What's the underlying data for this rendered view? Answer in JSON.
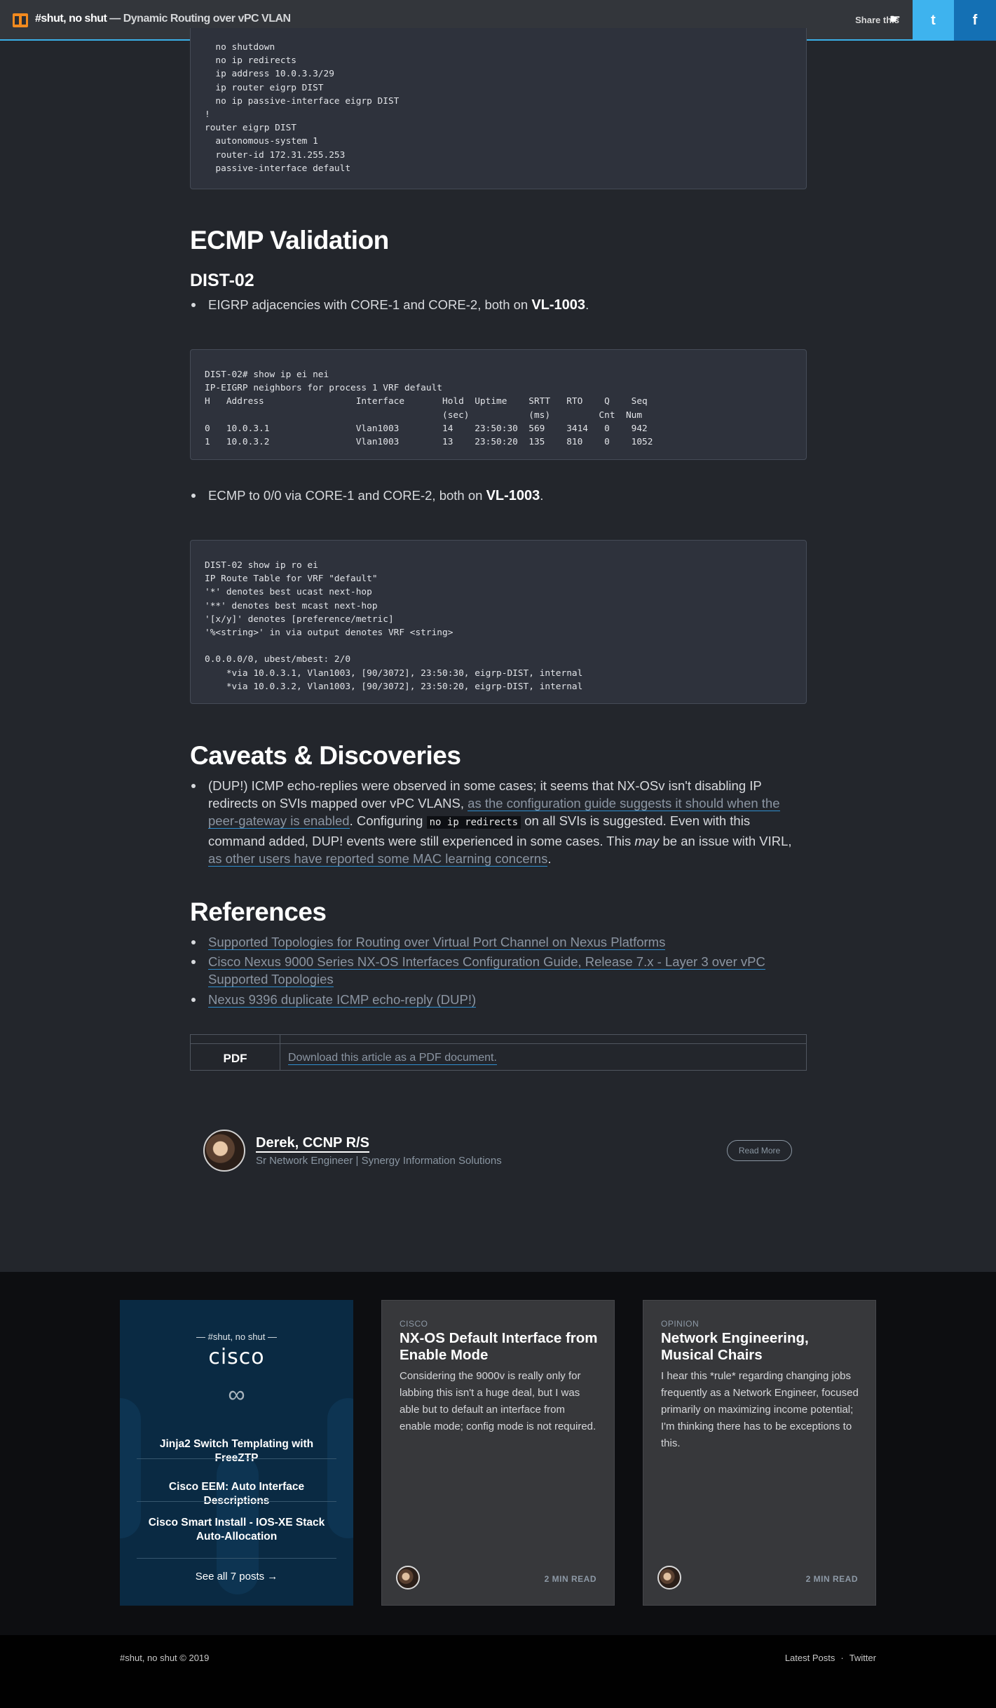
{
  "header": {
    "site_name": "#shut, no shut",
    "separator": " — ",
    "post_title": "Dynamic Routing over vPC VLAN",
    "share_label": "Share this",
    "twitter_glyph": "t",
    "facebook_glyph": "f"
  },
  "code_blocks": {
    "top": "  no shutdown\n  no ip redirects\n  ip address 10.0.3.3/29\n  ip router eigrp DIST\n  no ip passive-interface eigrp DIST\n!\nrouter eigrp DIST\n  autonomous-system 1\n  router-id 172.31.255.253\n  passive-interface default",
    "eigrp_neighbors": "DIST-02# show ip ei nei\nIP-EIGRP neighbors for process 1 VRF default\nH   Address                 Interface       Hold  Uptime    SRTT   RTO    Q    Seq\n                                            (sec)           (ms)         Cnt  Num\n0   10.0.3.1                Vlan1003        14    23:50:30  569    3414   0    942\n1   10.0.3.2                Vlan1003        13    23:50:20  135    810    0    1052",
    "ip_route": "DIST-02 show ip ro ei\nIP Route Table for VRF \"default\"\n'*' denotes best ucast next-hop\n'**' denotes best mcast next-hop\n'[x/y]' denotes [preference/metric]\n'%<string>' in via output denotes VRF <string>\n\n0.0.0.0/0, ubest/mbest: 2/0\n    *via 10.0.3.1, Vlan1003, [90/3072], 23:50:30, eigrp-DIST, internal\n    *via 10.0.3.2, Vlan1003, [90/3072], 23:50:20, eigrp-DIST, internal"
  },
  "ecmp": {
    "heading": "ECMP Validation",
    "subheading": "DIST-02",
    "bullet1_text": "EIGRP adjacencies with CORE-1 and CORE-2, both on ",
    "bullet1_bold": "VL-1003",
    "bullet1_end": ".",
    "bullet2_text": "ECMP to 0/0 via CORE-1 and CORE-2, both on ",
    "bullet2_bold": "VL-1003",
    "bullet2_end": "."
  },
  "caveats": {
    "heading": "Caveats & Discoveries",
    "p1": "(DUP!) ICMP echo-replies were observed in some cases; it seems that NX-OSv isn't disabling IP redirects on SVIs mapped over vPC VLANS, ",
    "link1": "as the configuration guide suggests it should when the peer-gateway is enabled",
    "p2": ". Configuring ",
    "code": "no ip redirects",
    "p3": " on all SVIs is suggested. Even with this command added, DUP! events were still experienced in some cases. This ",
    "em": "may",
    "p4": " be an issue with VIRL, ",
    "link2": "as other users have reported some MAC learning concerns",
    "p5": "."
  },
  "references": {
    "heading": "References",
    "items": [
      "Supported Topologies for Routing over Virtual Port Channel on Nexus Platforms",
      "Cisco Nexus 9000 Series NX-OS Interfaces Configuration Guide, Release 7.x - Layer 3 over vPC Supported Topologies",
      "Nexus 9396 duplicate ICMP echo-reply (DUP!)"
    ]
  },
  "pdf": {
    "label": "PDF",
    "link": "Download this article as a PDF document."
  },
  "author": {
    "name": "Derek, CCNP R/S",
    "role": "Sr Network Engineer | Synergy Information Solutions",
    "read_more": "Read More"
  },
  "related": {
    "tag_card": {
      "over_title": "— #shut, no shut —",
      "tag": "cisco",
      "posts": [
        "Jinja2 Switch Templating with FreeZTP",
        "Cisco EEM: Auto Interface Descriptions",
        "Cisco Smart Install - IOS-XE Stack Auto-Allocation"
      ],
      "see_all": "See all 7 posts →"
    },
    "post1": {
      "category": "CISCO",
      "title": "NX-OS Default Interface from Enable Mode",
      "excerpt": "Considering the 9000v is really only for labbing this isn't a huge deal, but I was able but to default an interface from enable mode; config mode is not required.",
      "read_time": "2 MIN READ"
    },
    "post2": {
      "category": "OPINION",
      "title": "Network Engineering, Musical Chairs",
      "excerpt": "I hear this *rule* regarding changing jobs frequently as a Network Engineer, focused primarily on maximizing income potential; I'm thinking there has to be exceptions to this.",
      "read_time": "2 MIN READ"
    }
  },
  "footer": {
    "copyright": "#shut, no shut © 2019",
    "nav": [
      "Latest Posts",
      "Twitter"
    ],
    "nav_sep": "·"
  },
  "colors": {
    "accent": "#3bb0e8",
    "twitter": "#3eb3ee",
    "facebook": "#1470b4",
    "background": "#23262c"
  },
  "icons": [
    "site-logo-icon",
    "pointing-hand-icon",
    "twitter-icon",
    "facebook-icon",
    "infinity-icon"
  ]
}
